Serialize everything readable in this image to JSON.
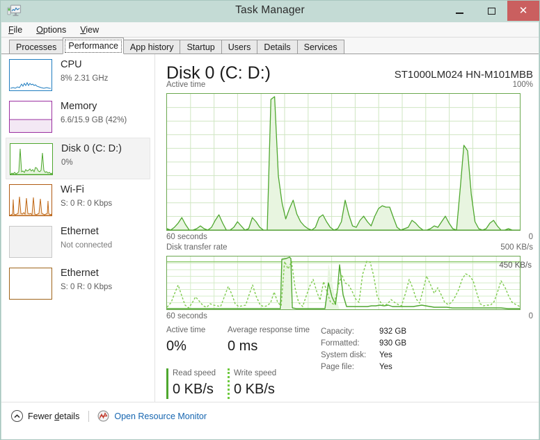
{
  "window": {
    "title": "Task Manager",
    "icon": "task-manager-icon",
    "minimize_label": "–",
    "maximize_label": "□",
    "close_label": "✕"
  },
  "menubar": {
    "items": [
      {
        "label": "File",
        "accel": "F"
      },
      {
        "label": "Options",
        "accel": "O"
      },
      {
        "label": "View",
        "accel": "V"
      }
    ]
  },
  "tabs": [
    {
      "label": "Processes",
      "selected": false
    },
    {
      "label": "Performance",
      "selected": true
    },
    {
      "label": "App history",
      "selected": false
    },
    {
      "label": "Startup",
      "selected": false
    },
    {
      "label": "Users",
      "selected": false
    },
    {
      "label": "Details",
      "selected": false
    },
    {
      "label": "Services",
      "selected": false
    }
  ],
  "sidebar": {
    "items": [
      {
        "name": "cpu",
        "title": "CPU",
        "subtitle": "8% 2.31 GHz",
        "color": "#1f7dc0",
        "fill": "#dbeaf5",
        "selected": false,
        "connected": true
      },
      {
        "name": "memory",
        "title": "Memory",
        "subtitle": "6.6/15.9 GB (42%)",
        "color": "#9a2fa0",
        "fill": "#f3e8f4",
        "selected": false,
        "connected": true
      },
      {
        "name": "disk-0",
        "title": "Disk 0 (C: D:)",
        "subtitle": "0%",
        "color": "#4ea72e",
        "fill": "#e6f4de",
        "selected": true,
        "connected": true
      },
      {
        "name": "wifi",
        "title": "Wi-Fi",
        "subtitle": "S: 0 R: 0 Kbps",
        "color": "#b05a12",
        "fill": "#f7e7d5",
        "selected": false,
        "connected": true
      },
      {
        "name": "ethernet-1",
        "title": "Ethernet",
        "subtitle": "Not connected",
        "color": "#c8c8c8",
        "fill": "#f2f2f2",
        "selected": false,
        "connected": false
      },
      {
        "name": "ethernet-2",
        "title": "Ethernet",
        "subtitle": "S: 0 R: 0 Kbps",
        "color": "#a0641a",
        "fill": "#ffffff",
        "selected": false,
        "connected": true
      }
    ]
  },
  "detail": {
    "device_title": "Disk 0 (C: D:)",
    "device_model": "ST1000LM024 HN-M101MBB",
    "graph_active": {
      "label": "Active time",
      "max_label": "100%",
      "time_label": "60 seconds",
      "zero_label": "0"
    },
    "graph_transfer": {
      "label": "Disk transfer rate",
      "max_label": "500 KB/s",
      "scale_annotation": "450 KB/s",
      "time_label": "60 seconds",
      "zero_label": "0"
    },
    "stats": {
      "active_time_label": "Active time",
      "active_time_value": "0%",
      "response_label": "Average response time",
      "response_value": "0 ms",
      "read_label": "Read speed",
      "read_value": "0 KB/s",
      "write_label": "Write speed",
      "write_value": "0 KB/s"
    },
    "info": [
      {
        "key": "Capacity:",
        "value": "932 GB"
      },
      {
        "key": "Formatted:",
        "value": "930 GB"
      },
      {
        "key": "System disk:",
        "value": "Yes"
      },
      {
        "key": "Page file:",
        "value": "Yes"
      }
    ]
  },
  "footer": {
    "fewer_details_label": "Fewer details",
    "fewer_details_accel": "d",
    "chevron_icon": "chevron-up-icon",
    "resource_monitor_label": "Open Resource Monitor",
    "resource_monitor_icon": "resource-monitor-icon"
  },
  "colors": {
    "titlebar": "#c4dbd5",
    "close_button": "#ca5f5f",
    "disk_accent": "#4ea72e",
    "disk_accent_light": "#6ec93f",
    "graph_fill": "#e6f4de",
    "grid": "#cfe6c2",
    "link": "#1565b0"
  },
  "chart_data": [
    {
      "type": "area",
      "name": "active-time",
      "title": "Active time",
      "ylabel": "",
      "xlabel": "60 seconds",
      "ylim": [
        0,
        100
      ],
      "xlim": [
        60,
        0
      ],
      "grid": true,
      "grid_cols": 15,
      "grid_rows": 10,
      "unit": "%",
      "values": [
        1,
        0,
        2,
        5,
        9,
        4,
        0,
        0,
        1,
        3,
        1,
        0,
        2,
        7,
        11,
        5,
        0,
        0,
        2,
        6,
        3,
        0,
        1,
        9,
        6,
        2,
        0,
        0,
        96,
        100,
        60,
        20,
        8,
        16,
        22,
        12,
        6,
        3,
        1,
        0,
        2,
        9,
        11,
        6,
        2,
        0,
        1,
        6,
        22,
        11,
        3,
        2,
        7,
        10,
        6,
        3,
        10,
        16,
        18,
        17,
        17,
        9,
        2,
        0,
        1,
        2,
        7,
        5,
        2,
        0,
        0,
        1,
        3,
        2,
        6,
        10,
        5,
        1,
        0,
        30,
        62,
        58,
        26,
        6,
        1,
        0,
        1,
        5,
        7,
        3,
        0,
        0,
        1,
        0
      ]
    },
    {
      "type": "line",
      "name": "disk-transfer-rate",
      "title": "Disk transfer rate",
      "ylabel": "KB/s",
      "xlabel": "60 seconds",
      "ylim": [
        0,
        500
      ],
      "xlim": [
        60,
        0
      ],
      "scale_annotation": "450 KB/s",
      "grid": true,
      "grid_cols": 15,
      "grid_rows": 8,
      "series": [
        {
          "name": "read",
          "style": "dashed",
          "color": "#6ec93f",
          "values": [
            20,
            60,
            150,
            230,
            130,
            40,
            10,
            60,
            120,
            70,
            30,
            20,
            50,
            40,
            35,
            30,
            110,
            220,
            140,
            50,
            25,
            30,
            40,
            130,
            230,
            120,
            40,
            25,
            30,
            60,
            160,
            60,
            30,
            450,
            380,
            450,
            200,
            60,
            25,
            120,
            210,
            280,
            170,
            80,
            260,
            160,
            70,
            50,
            220,
            330,
            250,
            230,
            170,
            100,
            60,
            330,
            450,
            440,
            300,
            120,
            60,
            30,
            50,
            90,
            60,
            40,
            30,
            140,
            260,
            180,
            90,
            50,
            180,
            320,
            240,
            140,
            200,
            130,
            60,
            40,
            60,
            110,
            180,
            310,
            360,
            340,
            270,
            150,
            50,
            30,
            35,
            40,
            70,
            180,
            260,
            170,
            90,
            50,
            30
          ]
        },
        {
          "name": "write",
          "style": "solid",
          "color": "#4ea72e",
          "values": [
            5,
            5,
            5,
            5,
            5,
            5,
            5,
            5,
            5,
            5,
            5,
            5,
            5,
            5,
            5,
            5,
            5,
            5,
            5,
            5,
            5,
            5,
            5,
            5,
            5,
            5,
            5,
            5,
            5,
            5,
            5,
            5,
            470,
            480,
            490,
            480,
            10,
            5,
            5,
            5,
            5,
            5,
            5,
            5,
            5,
            250,
            120,
            40,
            10,
            180,
            420,
            330,
            80,
            30,
            30,
            30,
            30,
            30,
            5,
            5,
            5,
            5,
            20,
            30,
            25,
            15,
            30,
            40,
            25,
            10,
            5,
            5,
            5,
            5,
            5,
            5,
            5,
            25,
            35,
            30,
            20,
            5,
            5,
            5,
            5,
            5,
            5,
            5,
            5,
            5,
            5,
            5,
            5,
            5,
            5,
            5,
            5,
            5
          ]
        }
      ]
    }
  ]
}
